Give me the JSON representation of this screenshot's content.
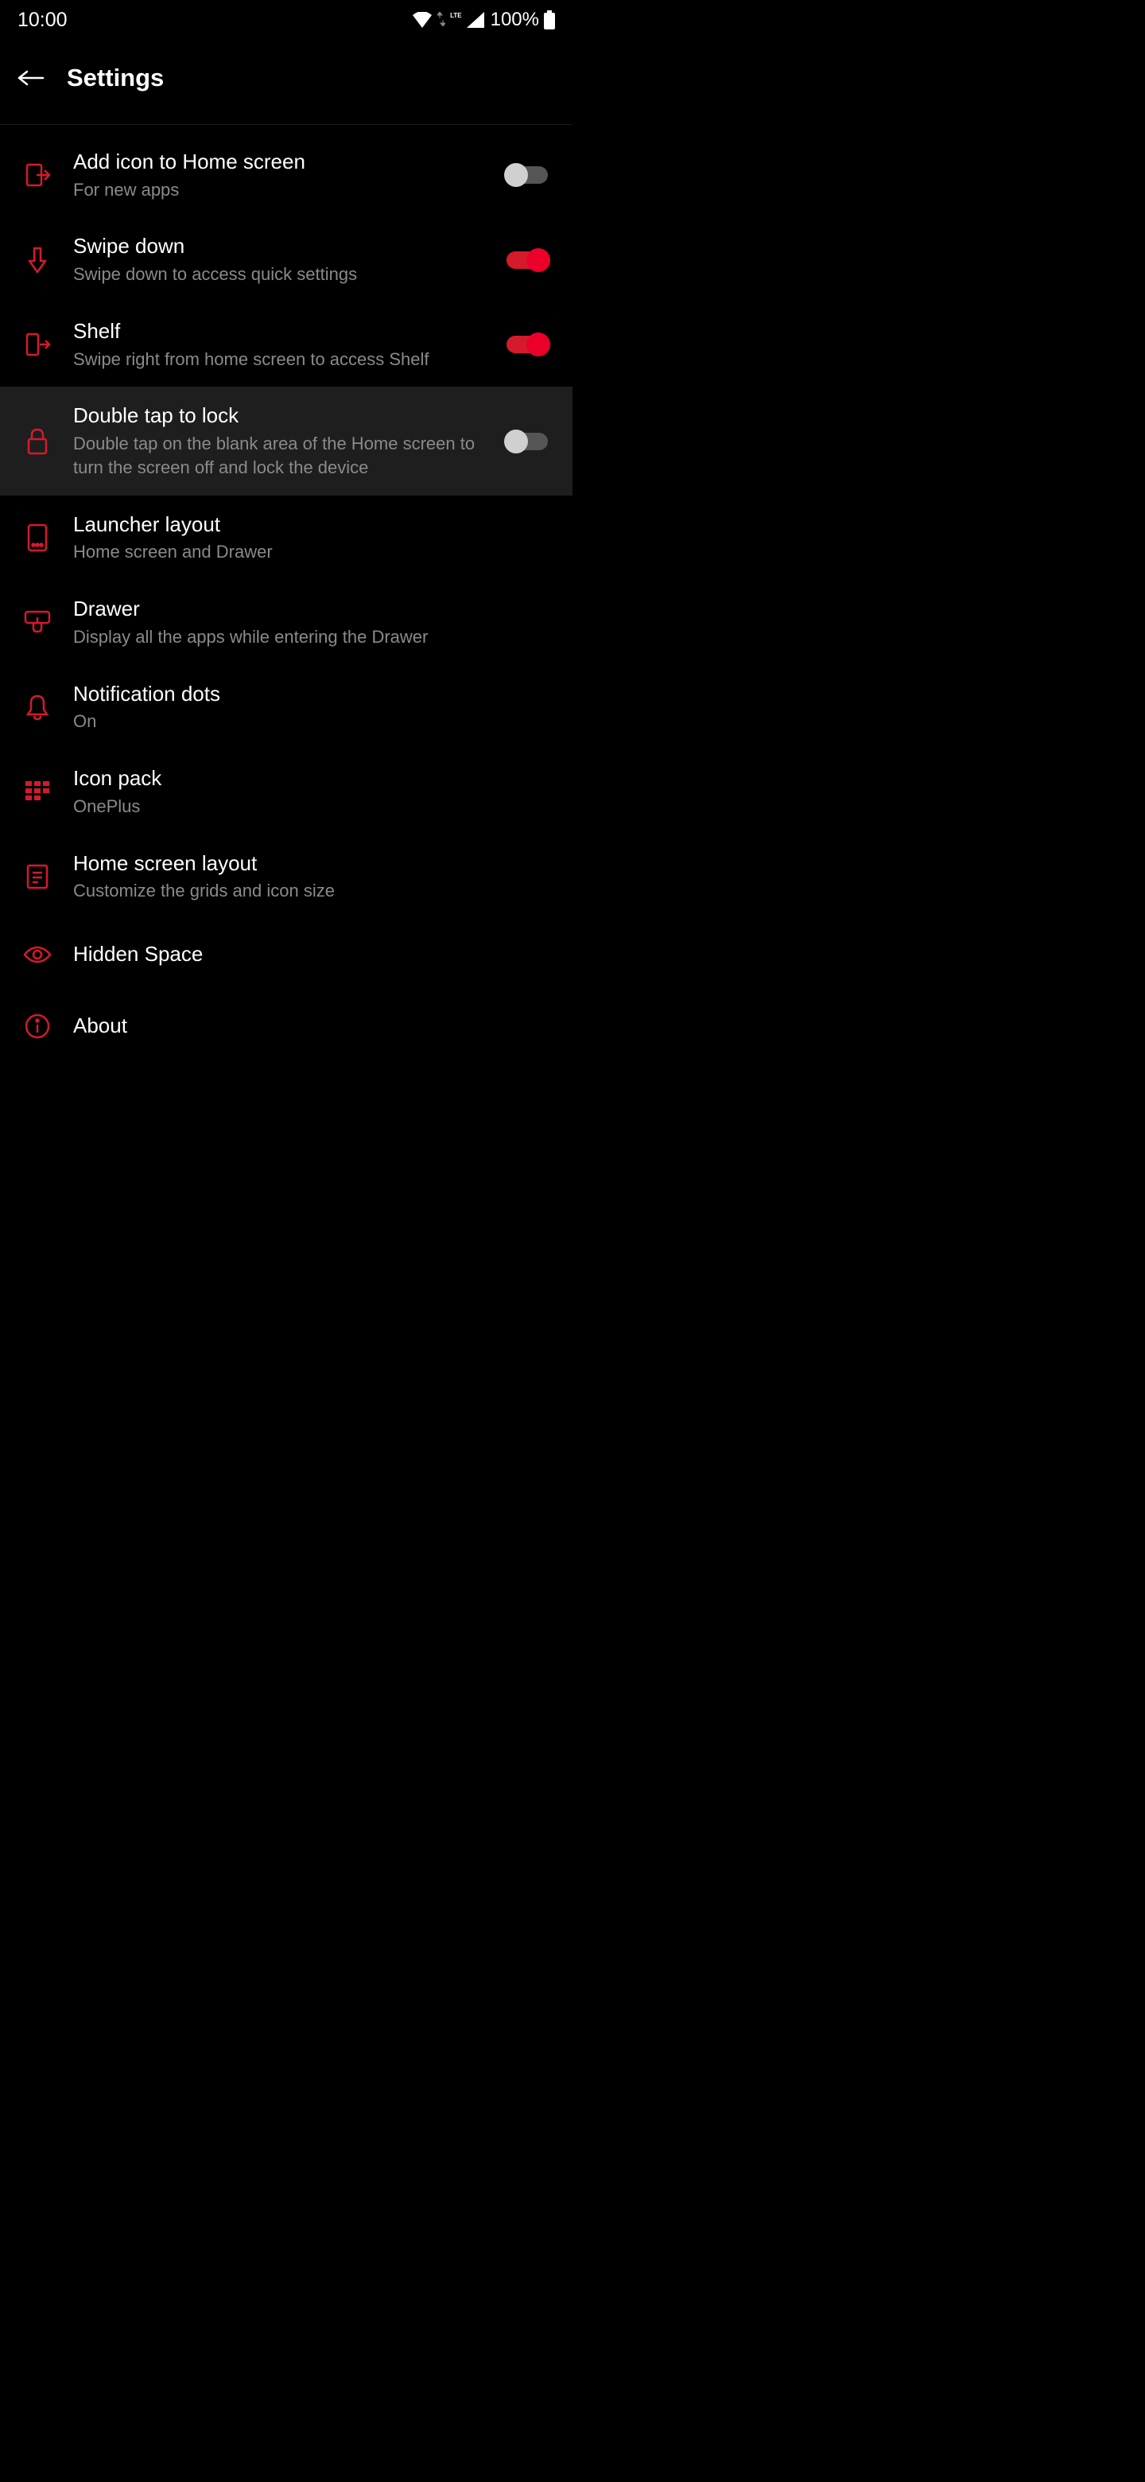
{
  "status_bar": {
    "time": "10:00",
    "lte": "LTE",
    "battery": "100%"
  },
  "header": {
    "title": "Settings"
  },
  "items": {
    "add_icon": {
      "title": "Add icon to Home screen",
      "subtitle": "For new apps",
      "toggle": false
    },
    "swipe_down": {
      "title": "Swipe down",
      "subtitle": "Swipe down to access quick settings",
      "toggle": true
    },
    "shelf": {
      "title": "Shelf",
      "subtitle": "Swipe right from home screen to access Shelf",
      "toggle": true
    },
    "double_tap": {
      "title": "Double tap to lock",
      "subtitle": "Double tap on the blank area of the Home screen to turn the screen off and lock the device",
      "toggle": false
    },
    "launcher_layout": {
      "title": "Launcher layout",
      "subtitle": "Home screen and Drawer"
    },
    "drawer": {
      "title": "Drawer",
      "subtitle": "Display all the apps while entering the Drawer"
    },
    "notification_dots": {
      "title": "Notification dots",
      "subtitle": "On"
    },
    "icon_pack": {
      "title": "Icon pack",
      "subtitle": "OnePlus"
    },
    "home_screen_layout": {
      "title": "Home screen layout",
      "subtitle": "Customize the grids and icon size"
    },
    "hidden_space": {
      "title": "Hidden Space"
    },
    "about": {
      "title": "About"
    }
  }
}
